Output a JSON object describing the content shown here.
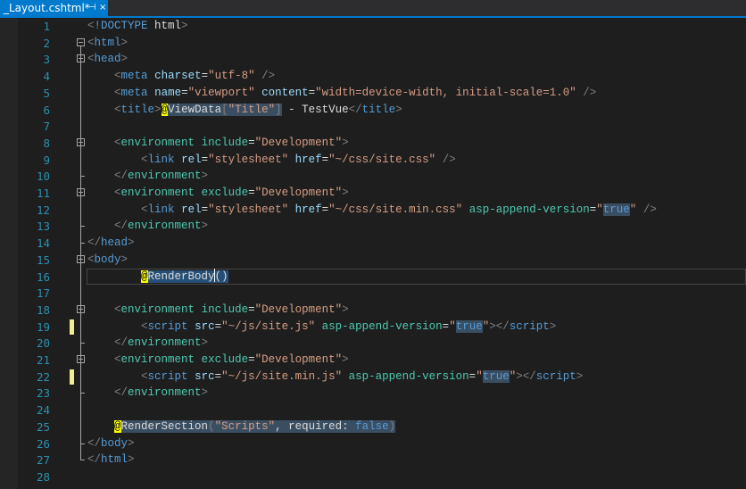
{
  "tab": {
    "title": "_Layout.cshtml*",
    "pin": "⊣",
    "close": "×"
  },
  "colors": {
    "tag": "#569cd6",
    "attr": "#9cdcfe",
    "string": "#d69d85",
    "text": "#dcdcdc",
    "delim": "#808080",
    "razor_tag": "#4ec9b0",
    "line_number": "#2b91af",
    "razor_marker": "#ffff00",
    "accent": "#007acc"
  },
  "lines": [
    {
      "n": "1",
      "t": [
        [
          "d",
          "<"
        ],
        [
          "g",
          "!DOCTYPE"
        ],
        [
          "x",
          " html"
        ],
        [
          "d",
          ">"
        ]
      ]
    },
    {
      "n": "2",
      "t": [
        [
          "d",
          "<"
        ],
        [
          "g",
          "html"
        ],
        [
          "d",
          ">"
        ]
      ]
    },
    {
      "n": "3",
      "t": [
        [
          "d",
          "<"
        ],
        [
          "g",
          "head"
        ],
        [
          "d",
          ">"
        ]
      ]
    },
    {
      "n": "4",
      "t": [
        [
          "x",
          "    "
        ],
        [
          "d",
          "<"
        ],
        [
          "g",
          "meta"
        ],
        [
          "x",
          " "
        ],
        [
          "a",
          "charset"
        ],
        [
          "x",
          "="
        ],
        [
          "s",
          "\"utf-8\""
        ],
        [
          "x",
          " "
        ],
        [
          "d",
          "/>"
        ]
      ]
    },
    {
      "n": "5",
      "t": [
        [
          "x",
          "    "
        ],
        [
          "d",
          "<"
        ],
        [
          "g",
          "meta"
        ],
        [
          "x",
          " "
        ],
        [
          "a",
          "name"
        ],
        [
          "x",
          "="
        ],
        [
          "s",
          "\"viewport\""
        ],
        [
          "x",
          " "
        ],
        [
          "a",
          "content"
        ],
        [
          "x",
          "="
        ],
        [
          "s",
          "\"width=device-width, initial-scale=1.0\""
        ],
        [
          "x",
          " "
        ],
        [
          "d",
          "/>"
        ]
      ]
    },
    {
      "n": "6",
      "t": [
        [
          "x",
          "    "
        ],
        [
          "d",
          "<"
        ],
        [
          "g",
          "title"
        ],
        [
          "d",
          ">"
        ],
        [
          "rz",
          "@"
        ],
        [
          "hx",
          "ViewData"
        ],
        [
          "hd",
          "["
        ],
        [
          "hs",
          "\"Title\""
        ],
        [
          "hd",
          "]"
        ],
        [
          "x",
          " - TestVue"
        ],
        [
          "d",
          "</"
        ],
        [
          "g",
          "title"
        ],
        [
          "d",
          ">"
        ]
      ]
    },
    {
      "n": "7",
      "t": []
    },
    {
      "n": "8",
      "t": [
        [
          "x",
          "    "
        ],
        [
          "d",
          "<"
        ],
        [
          "r",
          "environment"
        ],
        [
          "x",
          " "
        ],
        [
          "r",
          "include"
        ],
        [
          "x",
          "="
        ],
        [
          "s",
          "\"Development\""
        ],
        [
          "d",
          ">"
        ]
      ]
    },
    {
      "n": "9",
      "t": [
        [
          "x",
          "        "
        ],
        [
          "d",
          "<"
        ],
        [
          "g",
          "link"
        ],
        [
          "x",
          " "
        ],
        [
          "a",
          "rel"
        ],
        [
          "x",
          "="
        ],
        [
          "s",
          "\"stylesheet\""
        ],
        [
          "x",
          " "
        ],
        [
          "a",
          "href"
        ],
        [
          "x",
          "="
        ],
        [
          "s",
          "\"~/css/site.css\""
        ],
        [
          "x",
          " "
        ],
        [
          "d",
          "/>"
        ]
      ]
    },
    {
      "n": "10",
      "t": [
        [
          "x",
          "    "
        ],
        [
          "d",
          "</"
        ],
        [
          "r",
          "environment"
        ],
        [
          "d",
          ">"
        ]
      ]
    },
    {
      "n": "11",
      "t": [
        [
          "x",
          "    "
        ],
        [
          "d",
          "<"
        ],
        [
          "r",
          "environment"
        ],
        [
          "x",
          " "
        ],
        [
          "r",
          "exclude"
        ],
        [
          "x",
          "="
        ],
        [
          "s",
          "\"Development\""
        ],
        [
          "d",
          ">"
        ]
      ]
    },
    {
      "n": "12",
      "t": [
        [
          "x",
          "        "
        ],
        [
          "d",
          "<"
        ],
        [
          "g",
          "link"
        ],
        [
          "x",
          " "
        ],
        [
          "a",
          "rel"
        ],
        [
          "x",
          "="
        ],
        [
          "s",
          "\"stylesheet\""
        ],
        [
          "x",
          " "
        ],
        [
          "a",
          "href"
        ],
        [
          "x",
          "="
        ],
        [
          "s",
          "\"~/css/site.min.css\""
        ],
        [
          "x",
          " "
        ],
        [
          "r",
          "asp-append-version"
        ],
        [
          "x",
          "="
        ],
        [
          "s",
          "\""
        ],
        [
          "hg",
          "true"
        ],
        [
          "s",
          "\""
        ],
        [
          "x",
          " "
        ],
        [
          "d",
          "/>"
        ]
      ]
    },
    {
      "n": "13",
      "t": [
        [
          "x",
          "    "
        ],
        [
          "d",
          "</"
        ],
        [
          "r",
          "environment"
        ],
        [
          "d",
          ">"
        ]
      ]
    },
    {
      "n": "14",
      "t": [
        [
          "d",
          "</"
        ],
        [
          "g",
          "head"
        ],
        [
          "d",
          ">"
        ]
      ]
    },
    {
      "n": "15",
      "t": [
        [
          "d",
          "<"
        ],
        [
          "g",
          "body"
        ],
        [
          "d",
          ">"
        ]
      ]
    },
    {
      "n": "16",
      "t": [
        [
          "x",
          "        "
        ],
        [
          "rz",
          "@"
        ],
        [
          "sx",
          "RenderBody"
        ],
        [
          "cur",
          ""
        ],
        [
          "sx",
          "()"
        ]
      ]
    },
    {
      "n": "17",
      "t": []
    },
    {
      "n": "18",
      "t": [
        [
          "x",
          "    "
        ],
        [
          "d",
          "<"
        ],
        [
          "r",
          "environment"
        ],
        [
          "x",
          " "
        ],
        [
          "r",
          "include"
        ],
        [
          "x",
          "="
        ],
        [
          "s",
          "\"Development\""
        ],
        [
          "d",
          ">"
        ]
      ]
    },
    {
      "n": "19",
      "t": [
        [
          "x",
          "        "
        ],
        [
          "d",
          "<"
        ],
        [
          "g",
          "script"
        ],
        [
          "x",
          " "
        ],
        [
          "a",
          "src"
        ],
        [
          "x",
          "="
        ],
        [
          "s",
          "\"~/js/site.js\""
        ],
        [
          "x",
          " "
        ],
        [
          "r",
          "asp-append-version"
        ],
        [
          "x",
          "="
        ],
        [
          "s",
          "\""
        ],
        [
          "hg",
          "true"
        ],
        [
          "s",
          "\""
        ],
        [
          "d",
          "></"
        ],
        [
          "g",
          "script"
        ],
        [
          "d",
          ">"
        ]
      ]
    },
    {
      "n": "20",
      "t": [
        [
          "x",
          "    "
        ],
        [
          "d",
          "</"
        ],
        [
          "r",
          "environment"
        ],
        [
          "d",
          ">"
        ]
      ]
    },
    {
      "n": "21",
      "t": [
        [
          "x",
          "    "
        ],
        [
          "d",
          "<"
        ],
        [
          "r",
          "environment"
        ],
        [
          "x",
          " "
        ],
        [
          "r",
          "exclude"
        ],
        [
          "x",
          "="
        ],
        [
          "s",
          "\"Development\""
        ],
        [
          "d",
          ">"
        ]
      ]
    },
    {
      "n": "22",
      "t": [
        [
          "x",
          "        "
        ],
        [
          "d",
          "<"
        ],
        [
          "g",
          "script"
        ],
        [
          "x",
          " "
        ],
        [
          "a",
          "src"
        ],
        [
          "x",
          "="
        ],
        [
          "s",
          "\"~/js/site.min.js\""
        ],
        [
          "x",
          " "
        ],
        [
          "r",
          "asp-append-version"
        ],
        [
          "x",
          "="
        ],
        [
          "s",
          "\""
        ],
        [
          "hg",
          "true"
        ],
        [
          "s",
          "\""
        ],
        [
          "d",
          "></"
        ],
        [
          "g",
          "script"
        ],
        [
          "d",
          ">"
        ]
      ]
    },
    {
      "n": "23",
      "t": [
        [
          "x",
          "    "
        ],
        [
          "d",
          "</"
        ],
        [
          "r",
          "environment"
        ],
        [
          "d",
          ">"
        ]
      ]
    },
    {
      "n": "24",
      "t": []
    },
    {
      "n": "25",
      "t": [
        [
          "x",
          "    "
        ],
        [
          "rz",
          "@"
        ],
        [
          "hx",
          "RenderSection"
        ],
        [
          "hd",
          "("
        ],
        [
          "hs",
          "\"Scripts\""
        ],
        [
          "hx",
          ", required: "
        ],
        [
          "hg",
          "false"
        ],
        [
          "hd",
          ")"
        ]
      ]
    },
    {
      "n": "26",
      "t": [
        [
          "d",
          "</"
        ],
        [
          "g",
          "body"
        ],
        [
          "d",
          ">"
        ]
      ]
    },
    {
      "n": "27",
      "t": [
        [
          "d",
          "</"
        ],
        [
          "g",
          "html"
        ],
        [
          "d",
          ">"
        ]
      ]
    },
    {
      "n": "28",
      "t": []
    }
  ],
  "folds": [
    "2",
    "3",
    "8",
    "11",
    "15",
    "18",
    "21"
  ],
  "change_marks": [
    "19",
    "22"
  ]
}
